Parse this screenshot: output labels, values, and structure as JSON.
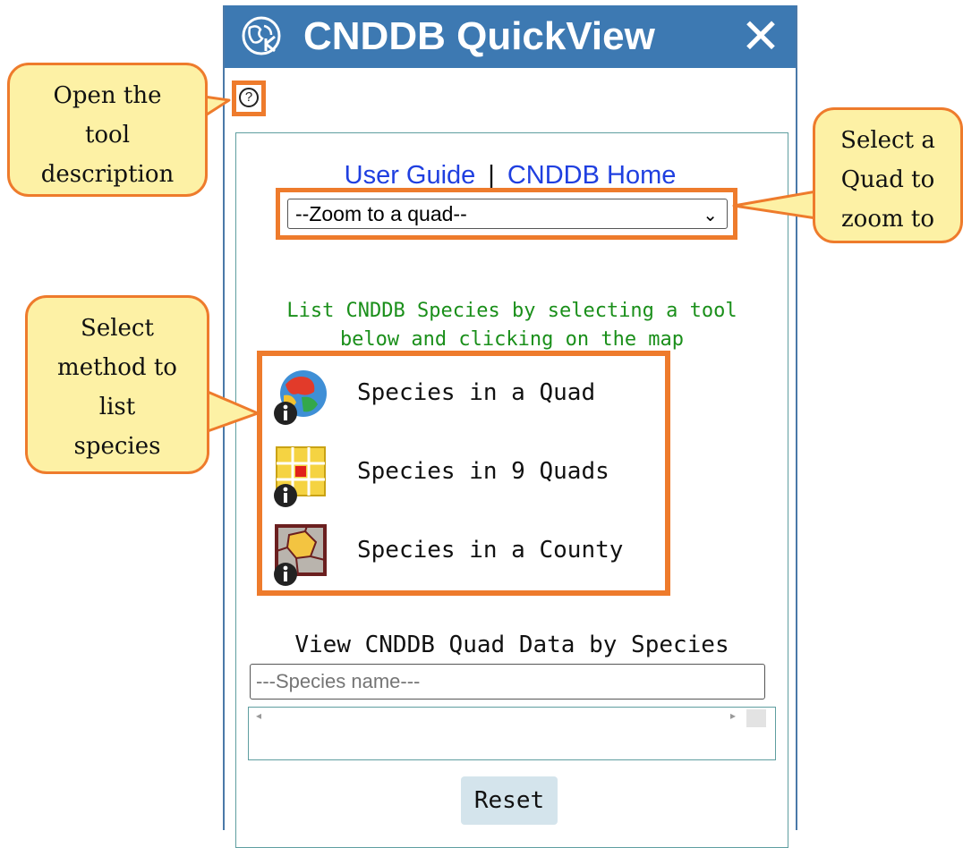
{
  "app": {
    "title": "CNDDB QuickView",
    "close": "✕",
    "help": "?"
  },
  "links": {
    "user_guide": "User Guide",
    "separator": "|",
    "home": "CNDDB Home"
  },
  "quad_select": {
    "value": "--Zoom to a quad--",
    "chevron": "⌄"
  },
  "instructions": {
    "line1": "List CNDDB Species by selecting a tool",
    "line2": "below and clicking on the map"
  },
  "tools": [
    {
      "label": "Species in a Quad",
      "icon": "quad-map-info-icon"
    },
    {
      "label": "Species in 9 Quads",
      "icon": "nine-quads-grid-info-icon"
    },
    {
      "label": "Species in a County",
      "icon": "county-map-info-icon"
    }
  ],
  "species": {
    "heading": "View CNDDB Quad Data by Species",
    "placeholder": "---Species name---"
  },
  "reset_label": "Reset",
  "callouts": {
    "help": [
      "Open the",
      "tool",
      "description"
    ],
    "quad": [
      "Select a",
      "Quad to",
      "zoom to"
    ],
    "method": [
      "Select",
      "method to",
      "list",
      "species"
    ]
  },
  "colors": {
    "titlebar": "#3d79b2",
    "highlight": "#ee7b2c",
    "callout_fill": "#fdf1a5",
    "instructions": "#1a8f1a",
    "link": "#1f3fe0"
  }
}
